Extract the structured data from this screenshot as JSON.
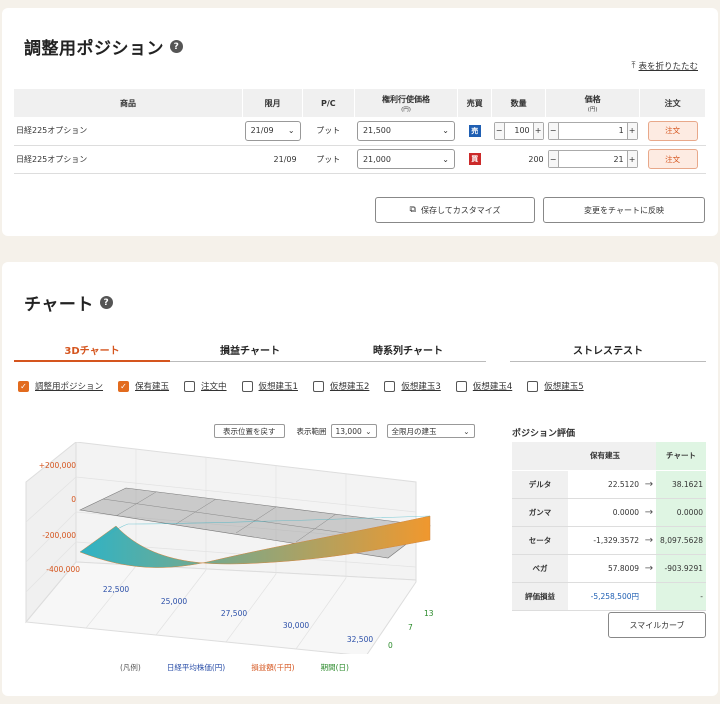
{
  "position": {
    "title": "調整用ポジション",
    "collapse_label": "表を折りたたむ",
    "headers": {
      "product": "商品",
      "expiry": "限月",
      "pc": "P/C",
      "strike": "権利行使価格",
      "strike_unit": "(円)",
      "side": "売買",
      "qty": "数量",
      "price": "価格",
      "price_unit": "(円)",
      "order": "注文"
    },
    "rows": [
      {
        "product": "日経225オプション",
        "expiry": "21/09",
        "pc": "プット",
        "strike": "21,500",
        "side": "売",
        "qty": "100",
        "price": "1",
        "order": "注文"
      },
      {
        "product": "日経225オプション",
        "expiry": "21/09",
        "pc": "プット",
        "strike": "21,000",
        "side": "買",
        "qty": "200",
        "price": "21",
        "order": "注文"
      }
    ],
    "save_label": "保存してカスタマイズ",
    "reflect_label": "変更をチャートに反映"
  },
  "chart": {
    "title": "チャート",
    "tabs": [
      "3Dチャート",
      "損益チャート",
      "時系列チャート",
      "ストレステスト"
    ],
    "checks": [
      {
        "label": "調整用ポジション",
        "checked": true
      },
      {
        "label": "保有建玉",
        "checked": true
      },
      {
        "label": "注文中",
        "checked": false
      },
      {
        "label": "仮想建玉1",
        "checked": false
      },
      {
        "label": "仮想建玉2",
        "checked": false
      },
      {
        "label": "仮想建玉3",
        "checked": false
      },
      {
        "label": "仮想建玉4",
        "checked": false
      },
      {
        "label": "仮想建玉5",
        "checked": false
      }
    ],
    "reset_view": "表示位置を戻す",
    "range_label": "表示範囲",
    "range_value": "13,000",
    "expiry_select": "全限月の建玉",
    "legend": {
      "prefix": "(凡例)",
      "x": "日経平均株価(円)",
      "y": "損益額(千円)",
      "z": "期間(日)"
    }
  },
  "chart_data": {
    "type": "surface",
    "x_ticks": [
      "22,500",
      "25,000",
      "27,500",
      "30,000",
      "32,500"
    ],
    "y_ticks": [
      "+200,000",
      "0",
      "-200,000",
      "-400,000"
    ],
    "z_ticks": [
      "0",
      "7",
      "13"
    ],
    "xlabel": "日経平均株価(円)",
    "ylabel": "損益額(千円)",
    "zlabel": "期間(日)",
    "colors": {
      "low": "#2fb3c5",
      "high": "#f0982e",
      "plane": "#9a9a9a"
    }
  },
  "evaluation": {
    "title": "ポジション評価",
    "col_held": "保有建玉",
    "col_chart": "チャート",
    "rows": [
      {
        "label": "デルタ",
        "held": "22.5120",
        "chart": "38.1621"
      },
      {
        "label": "ガンマ",
        "held": "0.0000",
        "chart": "0.0000"
      },
      {
        "label": "セータ",
        "held": "-1,329.3572",
        "chart": "8,097.5628"
      },
      {
        "label": "ベガ",
        "held": "57.8009",
        "chart": "-903.9291"
      },
      {
        "label": "評価損益",
        "held": "-5,258,500円",
        "chart": "-"
      }
    ],
    "smile_label": "スマイルカーブ"
  },
  "colors": {
    "accent": "#d5551e",
    "sell": "#1f5fb3",
    "buy": "#cc2a2a",
    "green": "#dff5e3"
  }
}
